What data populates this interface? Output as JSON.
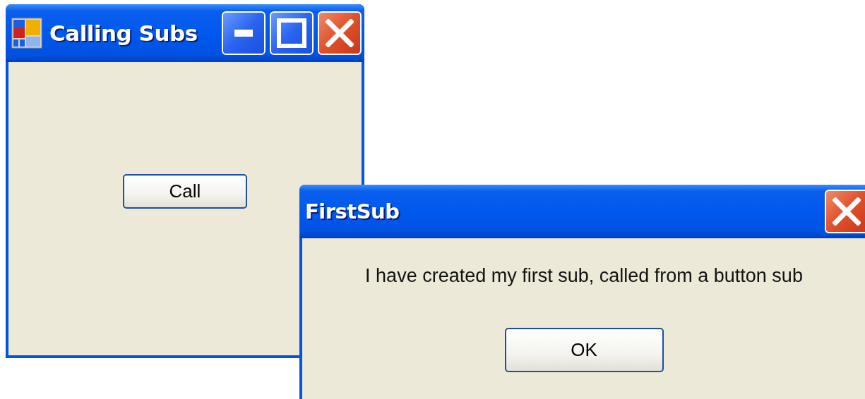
{
  "main_window": {
    "title": "Calling Subs",
    "controls": [
      {
        "kind": "minimize"
      },
      {
        "kind": "maximize"
      },
      {
        "kind": "close"
      }
    ],
    "button": "Call"
  },
  "dialog": {
    "title": "FirstSub",
    "controls": [
      {
        "kind": "close"
      }
    ],
    "message": "I have created my first sub, called from a button sub",
    "button": "OK"
  }
}
